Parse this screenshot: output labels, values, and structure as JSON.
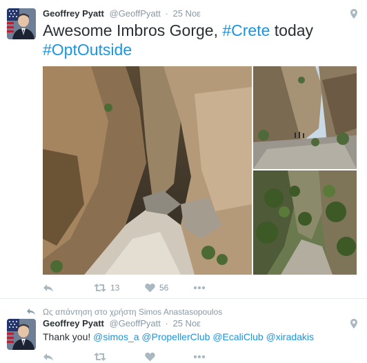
{
  "tweet1": {
    "author_name": "Geoffrey Pyatt",
    "author_handle": "@GeoffPyatt",
    "separator": "·",
    "timestamp": "25 Νοε",
    "text_part1": "Awesome Imbros Gorge,",
    "hashtag1": "#Crete",
    "text_part2": "today",
    "hashtag2": "#OptOutside",
    "retweet_count": "13",
    "like_count": "56"
  },
  "tweet2": {
    "reply_context": "Ως απάντηση στο χρήστη Simos Anastasopoulos",
    "author_name": "Geoffrey Pyatt",
    "author_handle": "@GeoffPyatt",
    "separator": "·",
    "timestamp": "25 Νοε",
    "text": "Thank you!",
    "mention1": "@simos_a",
    "mention2": "@PropellerClub",
    "mention3": "@EcaliClub",
    "mention4": "@xiradakis"
  },
  "colors": {
    "link": "#1b95e0",
    "text": "#292f33",
    "muted": "#8899a6",
    "icon": "#aab8c2"
  },
  "icons": [
    "avatar-flag-photo",
    "location-pin-icon",
    "reply-icon",
    "retweet-icon",
    "heart-icon",
    "more-icon"
  ]
}
